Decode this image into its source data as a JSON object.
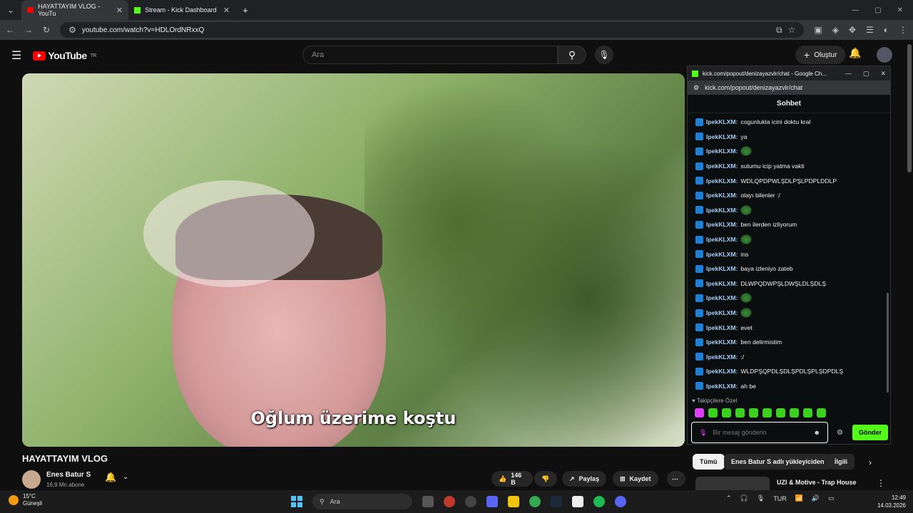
{
  "browser": {
    "tabs": [
      {
        "label": "HAYATTAYIM VLOG - YouTu"
      },
      {
        "label": "Stream - Kick Dashboard"
      }
    ],
    "url": "youtube.com/watch?v=HDLOrdNRxxQ"
  },
  "youtube": {
    "logo_text": "YouTube",
    "region": "TR",
    "search_placeholder": "Ara",
    "create_label": "Oluştur",
    "video_subtitle": "Oğlum üzerime koştu",
    "video_title": "HAYATTAYIM VLOG",
    "channel_name": "Enes Batur S",
    "channel_subs": "16,9 Mn abone",
    "likes": "146 B",
    "share_label": "Paylaş",
    "save_label": "Kaydet",
    "filters": [
      "Tümü",
      "Enes Batur S adlı yükleyiciden",
      "İlgili"
    ],
    "rec_title": "UZI & Motive - Trap House"
  },
  "chat_popout": {
    "window_title": "kick.com/popout/denizayazvlr/chat - Google Ch...",
    "url": "kick.com/popout/denizayazvlr/chat",
    "header": "Sohbet",
    "messages": [
      {
        "user": "IpekKLXM:",
        "text": "cogunlukla icini doktu kral"
      },
      {
        "user": "IpekKLXM:",
        "text": "ya"
      },
      {
        "user": "IpekKLXM:",
        "text": ""
      },
      {
        "user": "IpekKLXM:",
        "text": "sutumu icip yatma vakti"
      },
      {
        "user": "IpekKLXM:",
        "text": "WDLQPDPWLŞDLPŞLPDPLDDLP"
      },
      {
        "user": "IpekKLXM:",
        "text": "olayı bilenler :/"
      },
      {
        "user": "IpekKLXM:",
        "text": ""
      },
      {
        "user": "IpekKLXM:",
        "text": "ben ilerden izliyorum"
      },
      {
        "user": "IpekKLXM:",
        "text": ""
      },
      {
        "user": "IpekKLXM:",
        "text": "ins"
      },
      {
        "user": "IpekKLXM:",
        "text": "baya izleniyo zateb"
      },
      {
        "user": "IpekKLXM:",
        "text": "DLWPQDWPŞLDWŞLDLŞDLŞ"
      },
      {
        "user": "IpekKLXM:",
        "text": ""
      },
      {
        "user": "IpekKLXM:",
        "text": ""
      },
      {
        "user": "IpekKLXM:",
        "text": "evet"
      },
      {
        "user": "IpekKLXM:",
        "text": "ben delirmistim"
      },
      {
        "user": "IpekKLXM:",
        "text": ":/"
      },
      {
        "user": "IpekKLXM:",
        "text": "WLDPŞQPDLŞDLŞPDLŞPLŞDPDLŞ"
      },
      {
        "user": "IpekKLXM:",
        "text": "ah be"
      }
    ],
    "subs_only_label": "Takipçilere Özel",
    "input_placeholder": "Bir mesaj gönderin",
    "send_label": "Gönder"
  },
  "taskbar": {
    "temp": "15°C",
    "weather": "Güneşli",
    "search_placeholder": "Ara",
    "lang": "TUR",
    "time": "12:49",
    "date": "14.03.2026"
  },
  "colors": {
    "kick_green": "#53fc18",
    "yt_red": "#ff0000",
    "chat_user": "#a3cdf7"
  }
}
